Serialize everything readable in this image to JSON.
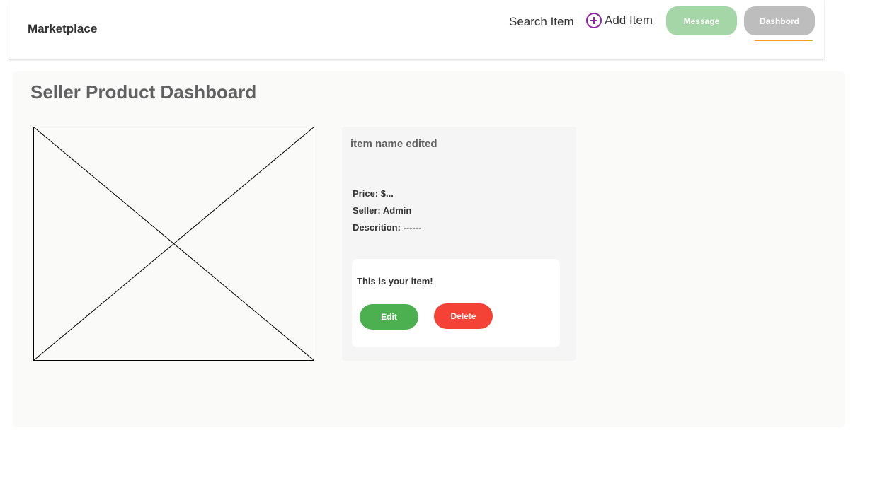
{
  "header": {
    "brand": "Marketplace",
    "nav": {
      "search_label": "Search Item",
      "add_label": "Add Item",
      "message_label": "Message",
      "dashboard_label": "Dashbord"
    }
  },
  "main": {
    "title": "Seller Product Dashboard",
    "item": {
      "name": "item name edited",
      "price": "Price: $...",
      "seller": "Seller: Admin",
      "description": "Descrition: ------",
      "owner_message": "This is your item!",
      "edit_label": "Edit",
      "delete_label": "Delete"
    }
  },
  "colors": {
    "accent_purple": "#8e24aa",
    "message_pill": "#a5d6a7",
    "dashboard_pill": "#bdbdbd",
    "edit_green": "#4caf50",
    "delete_red": "#f44336",
    "active_underline": "#f0a020"
  },
  "icons": {
    "add": "plus-circle-icon",
    "image": "image-placeholder"
  }
}
